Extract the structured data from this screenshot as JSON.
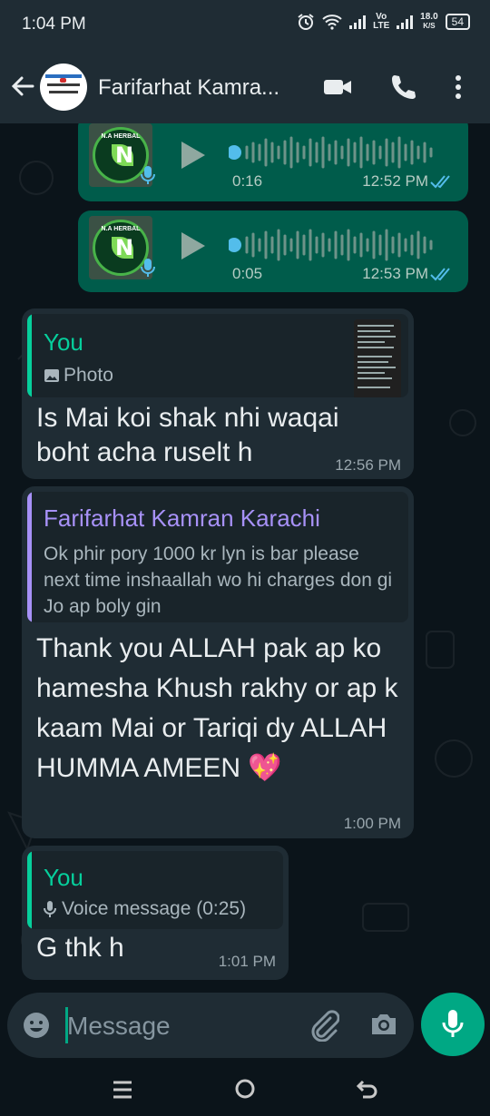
{
  "status_bar": {
    "time": "1:04 PM",
    "network_lte": "Vo LTE",
    "speed_value": "18.0",
    "speed_unit": "K/S",
    "battery": "54"
  },
  "header": {
    "contact_name": "Farifarhat Kamra...",
    "icons": [
      "back-arrow-icon",
      "video-call-icon",
      "phone-icon",
      "more-options-icon"
    ]
  },
  "messages": {
    "voice1": {
      "duration": "0:16",
      "time": "12:52 PM",
      "logo_text": "N.A HERBAL"
    },
    "voice2": {
      "duration": "0:05",
      "time": "12:53 PM",
      "logo_text": "N.A HERBAL"
    },
    "reply1": {
      "quote_name": "You",
      "quote_label": "Photo",
      "text": "Is Mai koi shak nhi waqai boht acha ruselt h",
      "time": "12:56 PM"
    },
    "reply2": {
      "quote_name": "Farifarhat Kamran Karachi",
      "quote_text": "Ok phir pory 1000 kr lyn is bar please next time inshaallah wo hi charges don gi Jo ap boly gin",
      "text": "Thank you ALLAH pak ap ko hamesha Khush rakhy or ap k kaam Mai or Tariqi dy ALLAH HUMMA AMEEN 💖",
      "time": "1:00 PM"
    },
    "reply3": {
      "quote_name": "You",
      "quote_label": "Voice message (0:25)",
      "text": "G thk h",
      "time": "1:01 PM"
    }
  },
  "composer": {
    "placeholder": "Message"
  },
  "colors": {
    "accent": "#00a884",
    "outgoing_bubble": "#005c4b",
    "incoming_bubble": "#1f2c34",
    "quote_you": "#06cf9c",
    "quote_contact": "#a791f7",
    "read_ticks": "#53bdeb"
  }
}
